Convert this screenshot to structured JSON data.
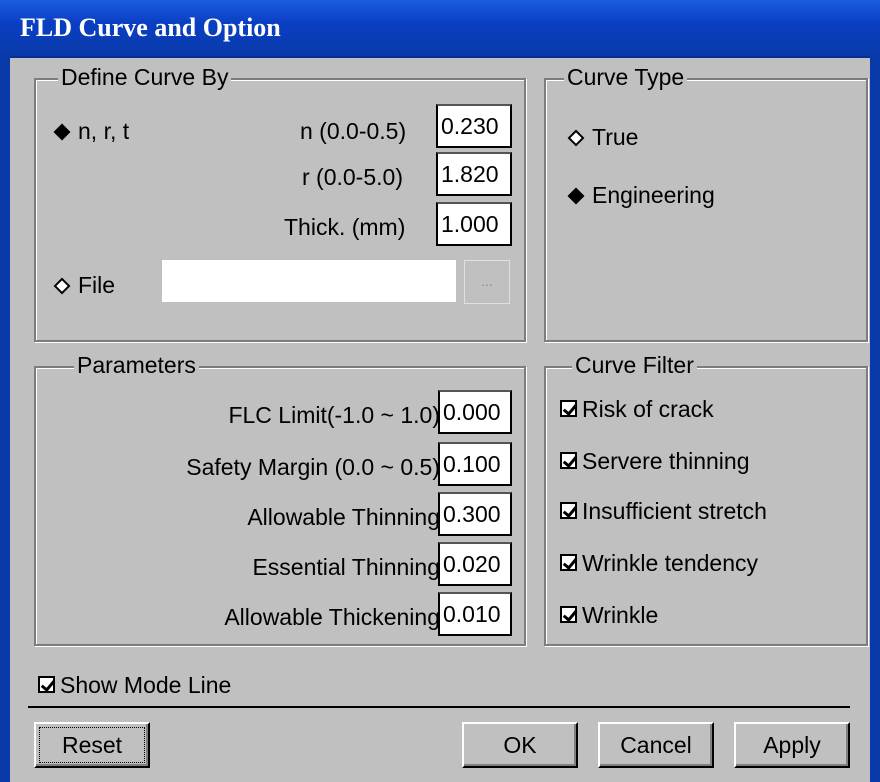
{
  "window": {
    "title": "FLD Curve and Option"
  },
  "define_curve": {
    "legend": "Define Curve By",
    "nrt_label": "n, r, t",
    "n_label": "n (0.0-0.5)",
    "n_value": "0.230",
    "r_label": "r (0.0-5.0)",
    "r_value": "1.820",
    "thick_label": "Thick. (mm)",
    "thick_value": "1.000",
    "file_label": "File",
    "file_value": "",
    "browse_label": "..."
  },
  "curve_type": {
    "legend": "Curve Type",
    "true_label": "True",
    "engineering_label": "Engineering"
  },
  "parameters": {
    "legend": "Parameters",
    "flc_label": "FLC Limit(-1.0 ~ 1.0)",
    "flc_value": "0.000",
    "safety_label": "Safety Margin (0.0 ~ 0.5)",
    "safety_value": "0.100",
    "allow_thin_label": "Allowable Thinning",
    "allow_thin_value": "0.300",
    "essential_label": "Essential Thinning",
    "essential_value": "0.020",
    "allow_thick_label": "Allowable Thickening",
    "allow_thick_value": "0.010"
  },
  "curve_filter": {
    "legend": "Curve Filter",
    "items": [
      "Risk of crack",
      "Servere thinning",
      "Insufficient stretch",
      "Wrinkle tendency",
      "Wrinkle"
    ]
  },
  "show_mode_line": "Show Mode Line",
  "buttons": {
    "reset": "Reset",
    "ok": "OK",
    "cancel": "Cancel",
    "apply": "Apply"
  }
}
